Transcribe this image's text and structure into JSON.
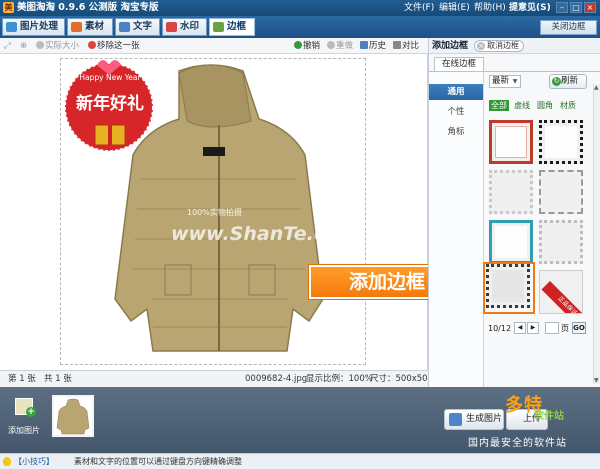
{
  "window": {
    "title": "美图淘淘 0.9.6 公测版 淘宝专版",
    "menu": [
      "文件(F)",
      "编辑(E)",
      "帮助(H)",
      "提意见(S)"
    ]
  },
  "tabs": [
    {
      "label": "图片处理",
      "color": "#3f8fd8"
    },
    {
      "label": "素材",
      "color": "#e06b2a"
    },
    {
      "label": "文字",
      "color": "#4d7fc4"
    },
    {
      "label": "水印",
      "color": "#d84444"
    },
    {
      "label": "边框",
      "color": "#6aa33f",
      "active": true
    }
  ],
  "close_frame_label": "关闭边框",
  "toolbar": {
    "actual_size": "实际大小",
    "remove_one": "移除这一张",
    "undo": "撤销",
    "redo": "重做",
    "history": "历史",
    "compare": "对比"
  },
  "canvas": {
    "badge_top": "Happy New Year",
    "badge_main": "新年好礼",
    "watermark_small": "100%实物拍摄",
    "watermark_large": "www.ShanTe.com"
  },
  "statusbar": {
    "current": "第 1 张",
    "total": "共 1 张",
    "filename": "0009682-4.jpg",
    "zoom": "显示比例：100%",
    "size": "尺寸：500x500"
  },
  "right_panel": {
    "title": "添加边框",
    "cancel": "取消边框",
    "online_tab": "在线边框",
    "categories": [
      "通用",
      "个性",
      "角标"
    ],
    "sort": "最新",
    "refresh": "刷新",
    "filters": [
      "全部",
      "虚线",
      "圆角",
      "材质"
    ],
    "corner_badge": "正品保证",
    "pager": {
      "page": "10/12",
      "prev": "◀",
      "next": "▶",
      "unit": "页",
      "go": "GO"
    }
  },
  "frame_thumbs": [
    {
      "border": "#c0392b",
      "style": "solid"
    },
    {
      "border": "#1a1a1a",
      "style": "dotted"
    },
    {
      "border": "#c9c9c9",
      "style": "dotted"
    },
    {
      "border": "#9a9a9a",
      "style": "dashed"
    },
    {
      "border": "#2e9fae",
      "style": "solid"
    },
    {
      "border": "#bdbdbd",
      "style": "dotted"
    },
    {
      "border": "#3a3a3a",
      "style": "dotted"
    },
    {
      "border": "#cc2222",
      "style": "corner"
    }
  ],
  "callout": "添加边框",
  "bottom": {
    "add_picture": "添加图片",
    "generate": "生成图片",
    "upload": "上传"
  },
  "watermark": {
    "logo": "多特",
    "logo_sub": "软件站",
    "site": "国内最安全的软件站"
  },
  "tip": {
    "label": "【小技巧】",
    "text": "素材和文字的位置可以通过键盘方向键精确调整"
  }
}
